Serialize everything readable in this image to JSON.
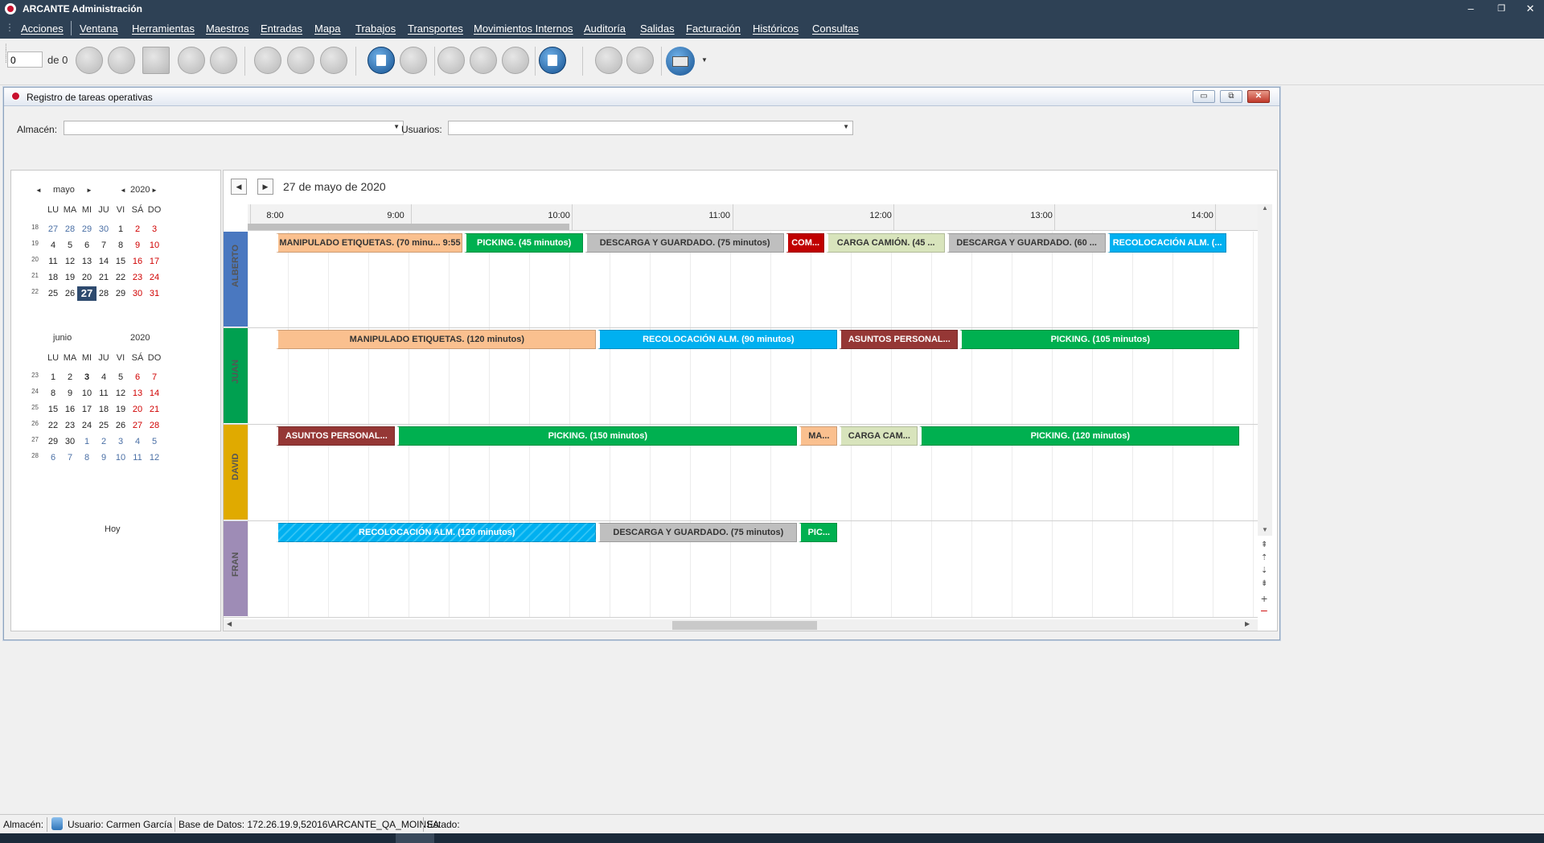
{
  "app": {
    "title": "ARCANTE Administración",
    "window_controls": {
      "minimize": "–",
      "restore": "❐",
      "close": "✕"
    }
  },
  "menu": {
    "items": [
      "Acciones",
      "Ventana",
      "Herramientas",
      "Maestros",
      "Entradas",
      "Mapa",
      "Trabajos",
      "Transportes",
      "Movimientos Internos",
      "Auditoría",
      "Salidas",
      "Facturación",
      "Históricos",
      "Consultas"
    ]
  },
  "toolbar": {
    "record_value": "0",
    "record_of": "de 0"
  },
  "child": {
    "title": "Registro de tareas operativas",
    "controls": {
      "minimize": "▭",
      "maximize": "⧉",
      "close": "✕"
    },
    "filters": {
      "almacen_label": "Almacén:",
      "almacen_value": "",
      "usuarios_label": "Usuarios:",
      "usuarios_value": ""
    }
  },
  "calendar": {
    "weekdays": [
      "LU",
      "MA",
      "MI",
      "JU",
      "VI",
      "SÁ",
      "DO"
    ],
    "months": [
      {
        "month": "mayo",
        "year": "2020",
        "weeks": [
          {
            "num": "18",
            "days": [
              "27",
              "28",
              "29",
              "30",
              "1",
              "2",
              "3"
            ]
          },
          {
            "num": "19",
            "days": [
              "4",
              "5",
              "6",
              "7",
              "8",
              "9",
              "10"
            ]
          },
          {
            "num": "20",
            "days": [
              "11",
              "12",
              "13",
              "14",
              "15",
              "16",
              "17"
            ]
          },
          {
            "num": "21",
            "days": [
              "18",
              "19",
              "20",
              "21",
              "22",
              "23",
              "24"
            ]
          },
          {
            "num": "22",
            "days": [
              "25",
              "26",
              "27",
              "28",
              "29",
              "30",
              "31"
            ]
          }
        ]
      },
      {
        "month": "junio",
        "year": "2020",
        "weeks": [
          {
            "num": "23",
            "days": [
              "1",
              "2",
              "3",
              "4",
              "5",
              "6",
              "7"
            ]
          },
          {
            "num": "24",
            "days": [
              "8",
              "9",
              "10",
              "11",
              "12",
              "13",
              "14"
            ]
          },
          {
            "num": "25",
            "days": [
              "15",
              "16",
              "17",
              "18",
              "19",
              "20",
              "21"
            ]
          },
          {
            "num": "26",
            "days": [
              "22",
              "23",
              "24",
              "25",
              "26",
              "27",
              "28"
            ]
          },
          {
            "num": "27",
            "days": [
              "29",
              "30",
              "1",
              "2",
              "3",
              "4",
              "5"
            ]
          },
          {
            "num": "28",
            "days": [
              "6",
              "7",
              "8",
              "9",
              "10",
              "11",
              "12"
            ]
          }
        ]
      }
    ],
    "selected_date": "27 mayo 2020",
    "today_label": "Hoy"
  },
  "scheduler": {
    "date_label": "27 de mayo de 2020",
    "time_labels": [
      "8:00",
      "9:00",
      "10:00",
      "11:00",
      "12:00",
      "13:00",
      "14:00"
    ],
    "resources": [
      {
        "name": "ALBERTO",
        "color": "#4a78c0",
        "appointments": [
          {
            "label": "MANIPULADO ETIQUETAS. (70 minu... 9:55",
            "start": "8:00",
            "end": "9:10",
            "color": "#fac08f",
            "text": "#333333"
          },
          {
            "label": "PICKING. (45 minutos)",
            "start": "9:10",
            "end": "9:55",
            "color": "#00b050",
            "text": "#ffffff"
          },
          {
            "label": "DESCARGA Y GUARDADO. (75 minutos)",
            "start": "9:55",
            "end": "11:10",
            "color": "#bfbfbf",
            "text": "#333333"
          },
          {
            "label": "COM...",
            "start": "11:10",
            "end": "11:25",
            "color": "#c00000",
            "text": "#ffffff"
          },
          {
            "label": "CARGA CAMIÓN. (45 ...",
            "start": "11:25",
            "end": "12:10",
            "color": "#d8e4bc",
            "text": "#333333"
          },
          {
            "label": "DESCARGA Y GUARDADO. (60 ...",
            "start": "12:10",
            "end": "13:10",
            "color": "#bfbfbf",
            "text": "#333333"
          },
          {
            "label": "RECOLOCACIÓN ALM. (...",
            "start": "13:10",
            "end": "13:55",
            "color": "#00b0f0",
            "text": "#ffffff"
          }
        ]
      },
      {
        "name": "JUAN",
        "color": "#00a050",
        "appointments": [
          {
            "label": "MANIPULADO ETIQUETAS. (120 minutos)",
            "start": "8:00",
            "end": "10:00",
            "color": "#fac08f",
            "text": "#333333"
          },
          {
            "label": "RECOLOCACIÓN ALM. (90 minutos)",
            "start": "10:00",
            "end": "11:30",
            "color": "#00b0f0",
            "text": "#ffffff"
          },
          {
            "label": "ASUNTOS PERSONAL...",
            "start": "11:30",
            "end": "12:15",
            "color": "#953735",
            "text": "#ffffff"
          },
          {
            "label": "PICKING. (105 minutos)",
            "start": "12:15",
            "end": "14:00",
            "color": "#00b050",
            "text": "#ffffff"
          }
        ]
      },
      {
        "name": "DAVID",
        "color": "#e0aa00",
        "appointments": [
          {
            "label": "ASUNTOS PERSONAL...",
            "start": "8:00",
            "end": "8:45",
            "color": "#953735",
            "text": "#ffffff"
          },
          {
            "label": "PICKING. (150 minutos)",
            "start": "8:45",
            "end": "11:15",
            "color": "#00b050",
            "text": "#ffffff"
          },
          {
            "label": "MA...",
            "start": "11:15",
            "end": "11:30",
            "color": "#fac08f",
            "text": "#333333"
          },
          {
            "label": "CARGA CAM...",
            "start": "11:30",
            "end": "12:00",
            "color": "#d8e4bc",
            "text": "#333333"
          },
          {
            "label": "PICKING. (120 minutos)",
            "start": "12:00",
            "end": "14:00",
            "color": "#00b050",
            "text": "#ffffff"
          }
        ]
      },
      {
        "name": "FRAN",
        "color": "#9e8cb6",
        "appointments": [
          {
            "label": "RECOLOCACIÓN ALM. (120 minutos)",
            "start": "8:00",
            "end": "10:00",
            "color": "#00b0f0",
            "text": "#ffffff"
          },
          {
            "label": "DESCARGA Y GUARDADO. (75 minutos)",
            "start": "10:00",
            "end": "11:15",
            "color": "#bfbfbf",
            "text": "#333333"
          },
          {
            "label": "PIC...",
            "start": "11:15",
            "end": "11:30",
            "color": "#00b050",
            "text": "#ffffff"
          }
        ]
      }
    ]
  },
  "status": {
    "almacen": "Almacén:",
    "usuario": "Usuario: Carmen García",
    "base_datos": "Base de Datos: 172.26.19.9,52016\\ARCANTE_QA_MOINSA",
    "estado": "Estado:"
  },
  "colors": {
    "titlebar": "#2e4155",
    "weekend": "#d00000",
    "other_month": "#4a6fa5"
  }
}
